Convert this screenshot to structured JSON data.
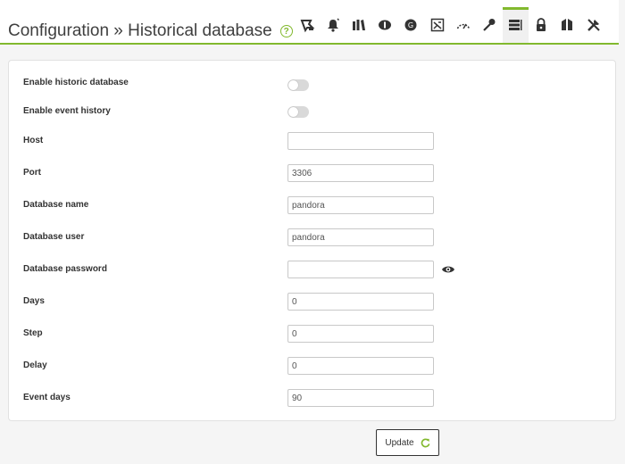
{
  "header": {
    "title": "Configuration » Historical database",
    "help_icon": "help-icon",
    "tabs": [
      {
        "icon": "general-setup-icon"
      },
      {
        "icon": "alert-bell-icon"
      },
      {
        "icon": "enterprise-icon"
      },
      {
        "icon": "password-icon"
      },
      {
        "icon": "external-tools-icon"
      },
      {
        "icon": "log-collector-icon"
      },
      {
        "icon": "performance-gauge-icon"
      },
      {
        "icon": "authentication-key-icon"
      },
      {
        "icon": "historical-database-icon",
        "active": true
      },
      {
        "icon": "security-lock-icon"
      },
      {
        "icon": "visual-styles-icon"
      },
      {
        "icon": "setup-tools-icon"
      }
    ]
  },
  "form": {
    "enable_historic_db": {
      "label": "Enable historic database",
      "enabled": false
    },
    "enable_event_history": {
      "label": "Enable event history",
      "enabled": false
    },
    "host": {
      "label": "Host",
      "value": ""
    },
    "port": {
      "label": "Port",
      "value": "3306"
    },
    "db_name": {
      "label": "Database name",
      "value": "pandora"
    },
    "db_user": {
      "label": "Database user",
      "value": "pandora"
    },
    "db_password": {
      "label": "Database password",
      "value": "",
      "show_icon": "eye-icon"
    },
    "days": {
      "label": "Days",
      "value": "0"
    },
    "step": {
      "label": "Step",
      "value": "0"
    },
    "delay": {
      "label": "Delay",
      "value": "0"
    },
    "event_days": {
      "label": "Event days",
      "value": "90"
    }
  },
  "actions": {
    "update_label": "Update",
    "update_icon": "refresh-icon"
  },
  "colors": {
    "accent": "#82b92e",
    "toggle_off": "#d9d9d9",
    "icon": "#333333"
  }
}
